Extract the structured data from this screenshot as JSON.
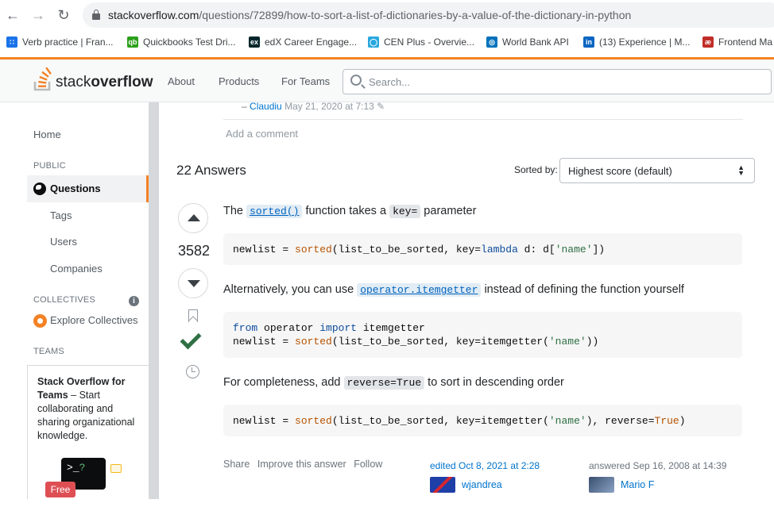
{
  "browser": {
    "url_host": "stackoverflow.com",
    "url_path": "/questions/72899/how-to-sort-a-list-of-dictionaries-by-a-value-of-the-dictionary-in-python",
    "bookmarks": [
      {
        "label": "Verb practice | Fran...",
        "icon": "grid-apps-icon",
        "color": "#1a73e8"
      },
      {
        "label": "Quickbooks Test Dri...",
        "icon": "quickbooks-icon",
        "color": "#2ca01c"
      },
      {
        "label": "edX Career Engage...",
        "icon": "edx-icon",
        "color": "#02262b"
      },
      {
        "label": "CEN Plus - Overvie...",
        "icon": "cen-icon",
        "color": "#29a8e0"
      },
      {
        "label": "World Bank API",
        "icon": "globe-icon",
        "color": "#0071bc"
      },
      {
        "label": "(13) Experience | M...",
        "icon": "linkedin-icon",
        "color": "#0a66c2"
      },
      {
        "label": "Frontend Ma",
        "icon": "frontend-masters-icon",
        "color": "#c02d28"
      }
    ]
  },
  "header": {
    "logo_light": "stack",
    "logo_bold": "overflow",
    "nav": [
      "About",
      "Products",
      "For Teams"
    ],
    "search_placeholder": "Search..."
  },
  "sidebar": {
    "home": "Home",
    "public_label": "PUBLIC",
    "questions": "Questions",
    "tags": "Tags",
    "users": "Users",
    "companies": "Companies",
    "collectives_label": "COLLECTIVES",
    "explore_collectives": "Explore Collectives",
    "teams_label": "TEAMS",
    "teams_title": "Stack Overflow for Teams",
    "teams_desc": " – Start collaborating and sharing organizational knowledge.",
    "teams_badge": "Free"
  },
  "comment": {
    "dash": "–",
    "user": "Claudiu",
    "date": "May 21, 2020 at 7:13",
    "add_comment": "Add a comment"
  },
  "answers": {
    "count_label": "22 Answers",
    "sorted_by_label": "Sorted by:",
    "sort_value": "Highest score (default)"
  },
  "answer": {
    "score": "3582",
    "p1_pre": "The ",
    "p1_code": "sorted()",
    "p1_mid": " function takes a ",
    "p1_code2": "key=",
    "p1_post": " parameter",
    "p2_pre": "Alternatively, you can use ",
    "p2_code": "operator.itemgetter",
    "p2_post": " instead of defining the function yourself",
    "p3_pre": "For completeness, add ",
    "p3_code": "reverse=True",
    "p3_post": " to sort in descending order",
    "menu": [
      "Share",
      "Improve this answer",
      "Follow"
    ],
    "edited": "edited Oct 8, 2021 at 2:28",
    "editor": "wjandrea",
    "answered": "answered Sep 16, 2008 at 14:39",
    "author": "Mario F"
  },
  "colors": {
    "accent": "#f48225",
    "link": "#0074cc",
    "accepted": "#2f6f44"
  }
}
